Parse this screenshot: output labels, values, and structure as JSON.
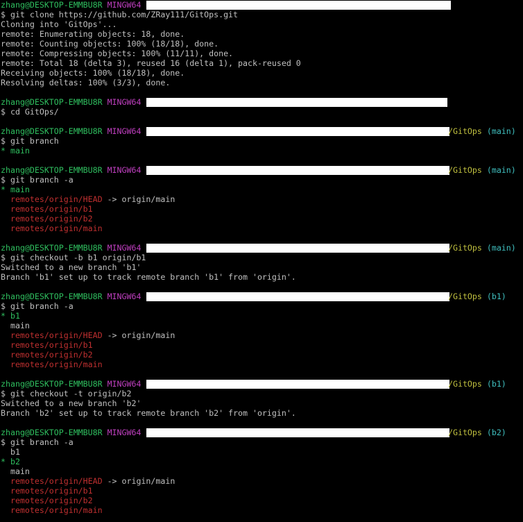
{
  "prompt": {
    "user_host": "zhang@DESKTOP-EMMBU8R",
    "shell": "MINGW64"
  },
  "blocks": [
    {
      "prompt_path": "",
      "prompt_branch": "",
      "command": "$ git clone https://github.com/ZRay111/GitOps.git",
      "output": [
        {
          "text": "Cloning into 'GitOps'...",
          "color": "white"
        },
        {
          "text": "remote: Enumerating objects: 18, done.",
          "color": "white"
        },
        {
          "text": "remote: Counting objects: 100% (18/18), done.",
          "color": "white"
        },
        {
          "text": "remote: Compressing objects: 100% (11/11), done.",
          "color": "white"
        },
        {
          "text": "remote: Total 18 (delta 3), reused 16 (delta 1), pack-reused 0",
          "color": "white"
        },
        {
          "text": "Receiving objects: 100% (18/18), done.",
          "color": "white"
        },
        {
          "text": "Resolving deltas: 100% (3/3), done.",
          "color": "white"
        }
      ]
    },
    {
      "prompt_path": "",
      "prompt_branch": "",
      "command": "$ cd GitOps/",
      "output": []
    },
    {
      "prompt_path": "/GitOps",
      "prompt_branch": "(main)",
      "command": "$ git branch",
      "output": [
        {
          "text": "* main",
          "color": "green"
        }
      ]
    },
    {
      "prompt_path": "/GitOps",
      "prompt_branch": "(main)",
      "command": "$ git branch -a",
      "output": [
        {
          "text": "* main",
          "color": "green"
        },
        {
          "text": "  remotes/origin/HEAD",
          "color": "red",
          "suffix": " -> origin/main"
        },
        {
          "text": "  remotes/origin/b1",
          "color": "red"
        },
        {
          "text": "  remotes/origin/b2",
          "color": "red"
        },
        {
          "text": "  remotes/origin/main",
          "color": "red"
        }
      ]
    },
    {
      "prompt_path": "/GitOps",
      "prompt_branch": "(main)",
      "command": "$ git checkout -b b1 origin/b1",
      "output": [
        {
          "text": "Switched to a new branch 'b1'",
          "color": "white"
        },
        {
          "text": "Branch 'b1' set up to track remote branch 'b1' from 'origin'.",
          "color": "white"
        }
      ]
    },
    {
      "prompt_path": "/GitOps",
      "prompt_branch": "(b1)",
      "command": "$ git branch -a",
      "output": [
        {
          "text": "* b1",
          "color": "green"
        },
        {
          "text": "  main",
          "color": "white"
        },
        {
          "text": "  remotes/origin/HEAD",
          "color": "red",
          "suffix": " -> origin/main"
        },
        {
          "text": "  remotes/origin/b1",
          "color": "red"
        },
        {
          "text": "  remotes/origin/b2",
          "color": "red"
        },
        {
          "text": "  remotes/origin/main",
          "color": "red"
        }
      ]
    },
    {
      "prompt_path": "/GitOps",
      "prompt_branch": "(b1)",
      "command": "$ git checkout -t origin/b2",
      "output": [
        {
          "text": "Switched to a new branch 'b2'",
          "color": "white"
        },
        {
          "text": "Branch 'b2' set up to track remote branch 'b2' from 'origin'.",
          "color": "white"
        }
      ]
    },
    {
      "prompt_path": "/GitOps",
      "prompt_branch": "(b2)",
      "command": "$ git branch -a",
      "output": [
        {
          "text": "  b1",
          "color": "white"
        },
        {
          "text": "* b2",
          "color": "green"
        },
        {
          "text": "  main",
          "color": "white"
        },
        {
          "text": "  remotes/origin/HEAD",
          "color": "red",
          "suffix": " -> origin/main"
        },
        {
          "text": "  remotes/origin/b1",
          "color": "red"
        },
        {
          "text": "  remotes/origin/b2",
          "color": "red"
        },
        {
          "text": "  remotes/origin/main",
          "color": "red"
        }
      ]
    }
  ]
}
